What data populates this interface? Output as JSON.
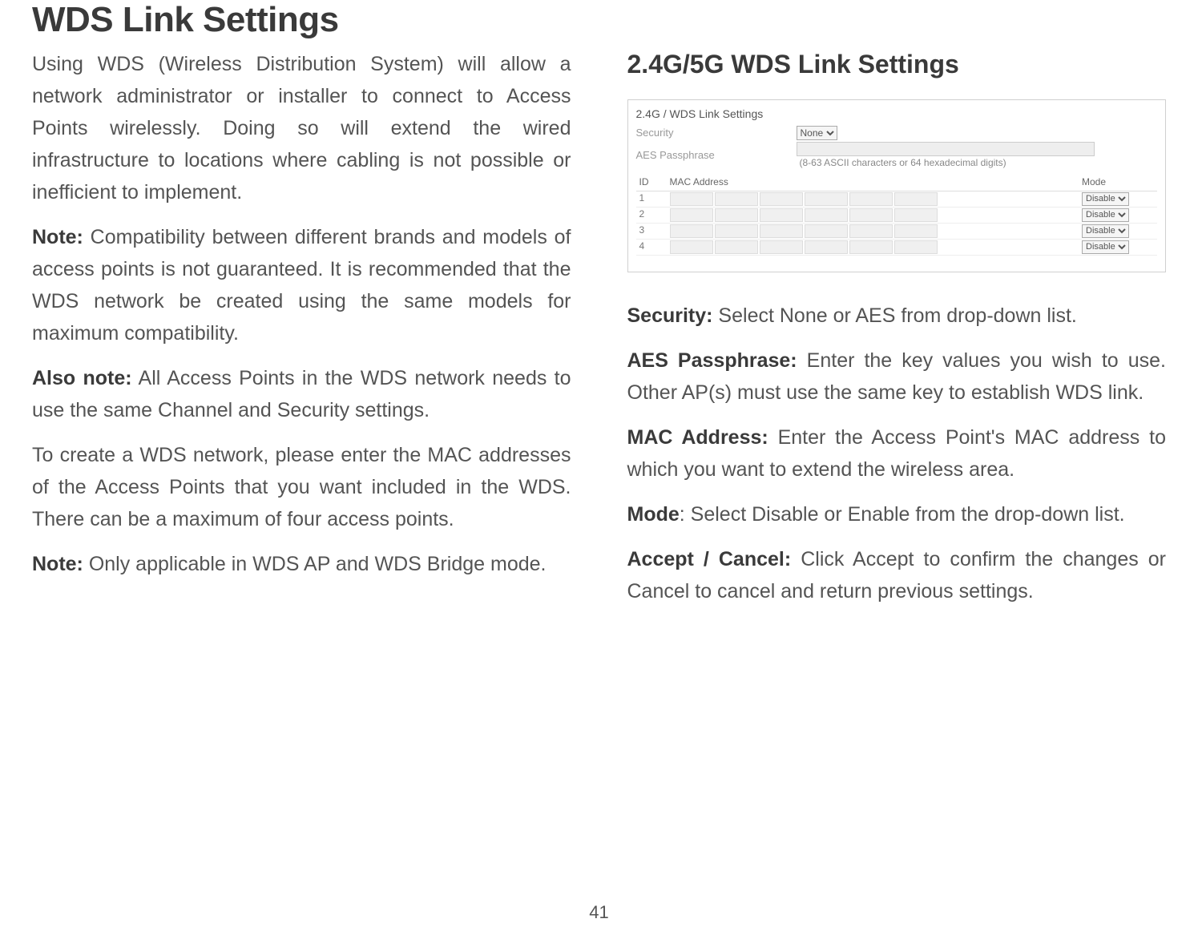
{
  "title": "WDS Link Settings",
  "left": {
    "intro": "Using WDS (Wireless Distribution System) will allow a network administrator or installer to connect to Access Points wirelessly. Doing so will extend the wired infrastructure to locations where cabling is not possible or inefficient to implement.",
    "note1_label": "Note:",
    "note1_text": " Compatibility between different brands and models of access points is not guaranteed. It is recommended that the WDS network be created using the same models for maximum compatibility.",
    "note2_label": "Also note:",
    "note2_text": " All Access Points in the WDS network needs to use the same Channel and Security settings.",
    "create": "To create a WDS network, please enter the MAC addresses of the Access Points that you want included in the WDS. There can be a maximum of four access points.",
    "note3_label": "Note:",
    "note3_text": " Only applicable in WDS AP and WDS Bridge mode."
  },
  "right": {
    "heading": "2.4G/5G WDS Link Settings",
    "screenshot": {
      "title": "2.4G / WDS Link Settings",
      "security_label": "Security",
      "security_value": "None",
      "passphrase_label": "AES Passphrase",
      "passphrase_hint": "(8-63 ASCII characters or 64 hexadecimal digits)",
      "col_id": "ID",
      "col_mac": "MAC Address",
      "col_mode": "Mode",
      "rows": [
        "1",
        "2",
        "3",
        "4"
      ],
      "mode_value": "Disable"
    },
    "fields": {
      "security_label": "Security:",
      "security_text": " Select None or AES from drop-down list.",
      "aes_label": "AES Passphrase:",
      "aes_text": " Enter the key values you wish to use. Other AP(s) must use the same key to establish WDS link.",
      "mac_label": "MAC Address:",
      "mac_text": " Enter the Access Point's MAC address to which you want to extend the wireless area.",
      "mode_label": "Mode",
      "mode_text": ": Select Disable or Enable from the drop-down list.",
      "accept_label": "Accept / Cancel:",
      "accept_text": " Click Accept to confirm the changes or Cancel to cancel and return previous settings."
    }
  },
  "page_number": "41"
}
